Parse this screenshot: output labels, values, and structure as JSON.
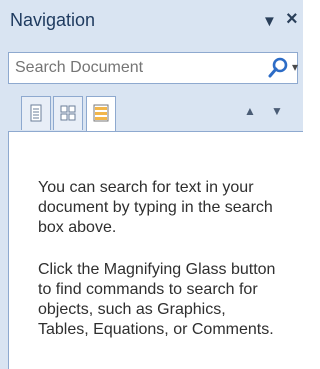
{
  "header": {
    "title": "Navigation"
  },
  "search": {
    "placeholder": "Search Document"
  },
  "tabs": [
    {
      "name": "headings",
      "icon": "page-icon",
      "selected": false
    },
    {
      "name": "pages",
      "icon": "thumbnails-icon",
      "selected": false
    },
    {
      "name": "results",
      "icon": "results-icon",
      "selected": true
    }
  ],
  "content": {
    "paragraph1": "You can search for text in your document by typing in the search box above.",
    "paragraph2": "Click the Magnifying Glass button to find commands to search for objects, such as Graphics, Tables, Equations, or Comments."
  },
  "colors": {
    "pane_background": "#d9e4f2",
    "border": "#8ea9cf",
    "accent_blue": "#2d6cc6",
    "text": "#2f2f2f"
  }
}
